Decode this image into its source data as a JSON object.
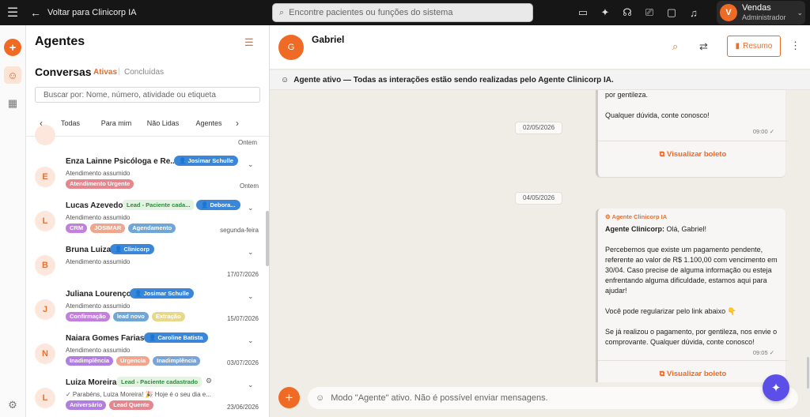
{
  "topbar": {
    "back_label": "Voltar para Clinicorp IA",
    "search_placeholder": "Encontre pacientes ou funções do sistema",
    "user": {
      "initial": "V",
      "name": "Vendas",
      "role": "Administrador"
    }
  },
  "list": {
    "title": "Agentes",
    "conversations_title": "Conversas",
    "tab_active": "Ativas",
    "tab_separator": "|",
    "tab_done": "Concluídas",
    "search_placeholder": "Buscar por: Nome, número, atividade ou etiqueta",
    "filters": [
      "Todas",
      "Para mim",
      "Não Lidas",
      "Agentes"
    ],
    "partial_date": "Ontem",
    "items": [
      {
        "initial": "E",
        "name": "Enza Lainne Psicóloga e Re...",
        "badge": "Josimar Schulle",
        "sub": "Atendimento assumido",
        "date": "Ontem",
        "tags": [
          {
            "label": "Atendimento Urgente",
            "color": "#e5868e"
          }
        ]
      },
      {
        "initial": "L",
        "name": "Lucas Azevedo",
        "green": "Lead - Paciente cada...",
        "badge": "Debora...",
        "sub": "Atendimento assumido",
        "date": "segunda-feira",
        "tags": [
          {
            "label": "CRM",
            "color": "#c47ee0"
          },
          {
            "label": "JOSIMAR",
            "color": "#f0a58c"
          },
          {
            "label": "Agendamento",
            "color": "#6fa6d6"
          }
        ]
      },
      {
        "initial": "B",
        "name": "Bruna Luiza",
        "badge": "Clinicorp",
        "sub": "Atendimento assumido",
        "date": "17/07/2026",
        "tags": []
      },
      {
        "initial": "J",
        "name": "Juliana Lourenço",
        "badge": "Josimar Schulle",
        "sub": "Atendimento assumido",
        "date": "15/07/2026",
        "tags": [
          {
            "label": "Confirmação",
            "color": "#c47ee0"
          },
          {
            "label": "lead novo",
            "color": "#6fa6d6"
          },
          {
            "label": "Extração",
            "color": "#e8d98a"
          }
        ]
      },
      {
        "initial": "N",
        "name": "Naiara Gomes Farias",
        "badge": "Caroline Batista",
        "sub": "Atendimento assumido",
        "date": "03/07/2026",
        "tags": [
          {
            "label": "Inadimplência",
            "color": "#b07ee0"
          },
          {
            "label": "Urgencia",
            "color": "#f0a58c"
          },
          {
            "label": "Inadimplência",
            "color": "#7aa3d6"
          }
        ]
      },
      {
        "initial": "L",
        "name": "Luiza Moreira",
        "green": "Lead - Paciente cadastrado",
        "sub": "✓ Parabéns, Luiza Moreira! 🎉 Hoje é o seu dia e...",
        "date": "23/06/2026",
        "tags": [
          {
            "label": "Aniversário",
            "color": "#b07ee0"
          },
          {
            "label": "Lead Quente",
            "color": "#e5868e"
          }
        ]
      }
    ]
  },
  "chat": {
    "contact_initial": "G",
    "contact_name": "Gabriel",
    "resumo_label": "Resumo",
    "agent_banner": "Agente ativo — Todas as interações estão sendo realizadas pelo Agente Clinicorp IA.",
    "date1": "02/05/2026",
    "date2": "04/05/2026",
    "msg1": {
      "text": "por gentileza.\n\nQualquer dúvida, conte conosco!",
      "time": "09:00 ✓",
      "link": "Visualizar boleto"
    },
    "msg2": {
      "agent": "Agente Clinicorp IA",
      "text_bold": "Agente Clinicorp:",
      "text": " Olá, Gabriel!\n\nPercebemos que existe um pagamento pendente, referente ao valor de R$ 1.100,00 com vencimento em 30/04. Caso precise de alguma informação ou esteja enfrentando alguma dificuldade, estamos aqui para ajudar!\n\nVocê pode regularizar pelo link abaixo 👇\n\nSe já realizou o pagamento, por gentileza, nos envie o comprovante. Qualquer dúvida, conte conosco!",
      "time": "09:05 ✓",
      "link": "Visualizar boleto"
    },
    "composer_placeholder": "Modo \"Agente\" ativo. Não é possível enviar mensagens."
  },
  "colors": {
    "accent": "#ef6a25",
    "badge_blue": "#3a86d9",
    "fab": "#5b4fe8"
  }
}
